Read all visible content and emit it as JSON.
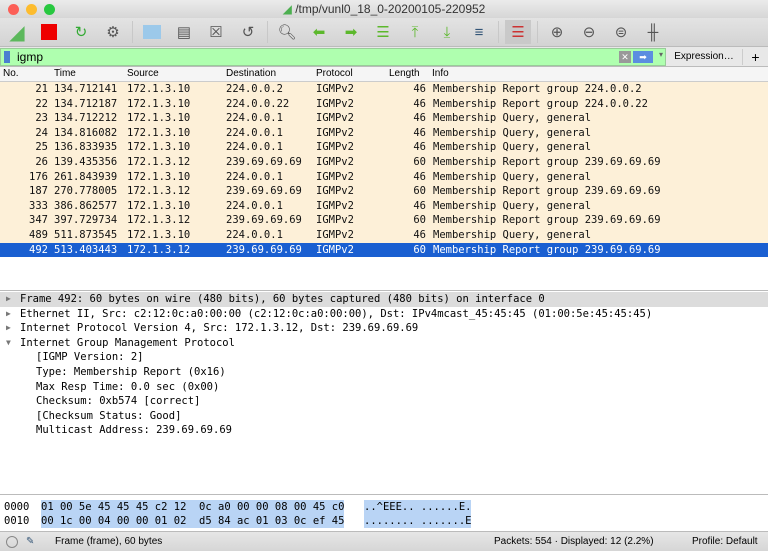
{
  "window": {
    "title": "/tmp/vunl0_18_0-20200105-220952"
  },
  "filter": {
    "value": "igmp",
    "expression_label": "Expression…",
    "add_label": "+"
  },
  "columns": [
    "No.",
    "Time",
    "Source",
    "Destination",
    "Protocol",
    "Length",
    "Info"
  ],
  "packets": [
    [
      "21",
      "134.712141",
      "172.1.3.10",
      "224.0.0.2",
      "IGMPv2",
      "46",
      "Membership Report group 224.0.0.2"
    ],
    [
      "22",
      "134.712187",
      "172.1.3.10",
      "224.0.0.22",
      "IGMPv2",
      "46",
      "Membership Report group 224.0.0.22"
    ],
    [
      "23",
      "134.712212",
      "172.1.3.10",
      "224.0.0.1",
      "IGMPv2",
      "46",
      "Membership Query, general"
    ],
    [
      "24",
      "134.816082",
      "172.1.3.10",
      "224.0.0.1",
      "IGMPv2",
      "46",
      "Membership Query, general"
    ],
    [
      "25",
      "136.833935",
      "172.1.3.10",
      "224.0.0.1",
      "IGMPv2",
      "46",
      "Membership Query, general"
    ],
    [
      "26",
      "139.435356",
      "172.1.3.12",
      "239.69.69.69",
      "IGMPv2",
      "60",
      "Membership Report group 239.69.69.69"
    ],
    [
      "176",
      "261.843939",
      "172.1.3.10",
      "224.0.0.1",
      "IGMPv2",
      "46",
      "Membership Query, general"
    ],
    [
      "187",
      "270.778005",
      "172.1.3.12",
      "239.69.69.69",
      "IGMPv2",
      "60",
      "Membership Report group 239.69.69.69"
    ],
    [
      "333",
      "386.862577",
      "172.1.3.10",
      "224.0.0.1",
      "IGMPv2",
      "46",
      "Membership Query, general"
    ],
    [
      "347",
      "397.729734",
      "172.1.3.12",
      "239.69.69.69",
      "IGMPv2",
      "60",
      "Membership Report group 239.69.69.69"
    ],
    [
      "489",
      "511.873545",
      "172.1.3.10",
      "224.0.0.1",
      "IGMPv2",
      "46",
      "Membership Query, general"
    ],
    [
      "492",
      "513.403443",
      "172.1.3.12",
      "239.69.69.69",
      "IGMPv2",
      "60",
      "Membership Report group 239.69.69.69"
    ]
  ],
  "selected_index": 11,
  "details": [
    {
      "text": "Frame 492: 60 bytes on wire (480 bits), 60 bytes captured (480 bits) on interface 0",
      "level": 0,
      "expanded": false
    },
    {
      "text": "Ethernet II, Src: c2:12:0c:a0:00:00 (c2:12:0c:a0:00:00), Dst: IPv4mcast_45:45:45 (01:00:5e:45:45:45)",
      "level": 0,
      "expanded": false
    },
    {
      "text": "Internet Protocol Version 4, Src: 172.1.3.12, Dst: 239.69.69.69",
      "level": 0,
      "expanded": false
    },
    {
      "text": "Internet Group Management Protocol",
      "level": 0,
      "expanded": true
    },
    {
      "text": "[IGMP Version: 2]",
      "level": 1
    },
    {
      "text": "Type: Membership Report (0x16)",
      "level": 1
    },
    {
      "text": "Max Resp Time: 0.0 sec (0x00)",
      "level": 1
    },
    {
      "text": "Checksum: 0xb574 [correct]",
      "level": 1
    },
    {
      "text": "[Checksum Status: Good]",
      "level": 1
    },
    {
      "text": "Multicast Address: 239.69.69.69",
      "level": 1
    }
  ],
  "hex": [
    {
      "offset": "0000",
      "bytes": "01 00 5e 45 45 45 c2 12  0c a0 00 00 08 00 45 c0",
      "ascii": "..^EEE.. ......E."
    },
    {
      "offset": "0010",
      "bytes": "00 1c 00 04 00 00 01 02  d5 84 ac 01 03 0c ef 45",
      "ascii": "........ .......E"
    }
  ],
  "status": {
    "frame": "Frame (frame), 60 bytes",
    "packets": "Packets: 554 · Displayed: 12 (2.2%)",
    "profile": "Profile: Default"
  }
}
